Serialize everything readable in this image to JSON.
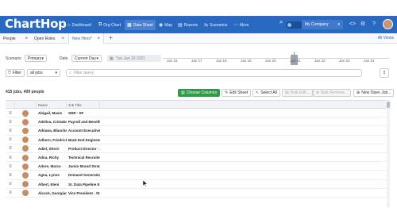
{
  "app": {
    "logo": "ChartHop",
    "nav": [
      {
        "label": "Dashboard",
        "icon": "⌂"
      },
      {
        "label": "Org Chart",
        "icon": "⧉"
      },
      {
        "label": "Data Sheet",
        "icon": "▦"
      },
      {
        "label": "Map",
        "icon": "◉"
      },
      {
        "label": "Reports",
        "icon": "▤"
      },
      {
        "label": "Scenarios",
        "icon": "⇆"
      },
      {
        "label": "More",
        "icon": "⋯"
      }
    ],
    "company": "My Company",
    "accent": "#2a69c2"
  },
  "tabs": [
    {
      "label": "People"
    },
    {
      "label": "Open Roles"
    },
    {
      "label": "New Hires*"
    }
  ],
  "all_views": "All Views",
  "scenario": {
    "label": "Scenario",
    "value": "Primary"
  },
  "date": {
    "label": "Date",
    "value": "Current Day",
    "selected": "Tue Jan 19 2021"
  },
  "timeline_ticks": [
    "Jan 16",
    "Jan 17",
    "Jan 18",
    "Jan 19",
    "Jan 20",
    "Jan 21",
    "Jan 22",
    "Jan 23",
    "Jan 24"
  ],
  "filter": {
    "button": "Filter",
    "jobs": "all jobs",
    "placeholder": "Filter query"
  },
  "count_text": "415 jobs, 409 people",
  "actions": {
    "choose_columns": "Choose Columns",
    "edit_sheet": "Edit Sheet",
    "select_all": "Select All",
    "bulk_edit": "Bulk Edit...",
    "bulk_remove": "Bulk Remove...",
    "new_open_job": "New Open Job..."
  },
  "columns": [
    "Name",
    "Job Title"
  ],
  "rows": [
    {
      "name": "Abigail, Maxie",
      "title": "SDR - SF"
    },
    {
      "name": "Adelina, Cristabel",
      "title": "Payroll and Benefits"
    },
    {
      "name": "Adriana, Blanche",
      "title": "Account Executive..."
    },
    {
      "name": "Adhern, Friedrick",
      "title": "Back End Engineer"
    },
    {
      "name": "Adiel, Sherri",
      "title": "Product Director - ..."
    },
    {
      "name": "Adna, Richy",
      "title": "Technical Recruiter"
    },
    {
      "name": "Adore, Marco",
      "title": "Junior Brand Strat..."
    },
    {
      "name": "Agna, Lynne",
      "title": "Demand Generatio..."
    },
    {
      "name": "Albert, Eleni",
      "title": "Sr. Data Pipeline E..."
    },
    {
      "name": "Alcock, Georgiana",
      "title": "Vice President - St..."
    }
  ]
}
